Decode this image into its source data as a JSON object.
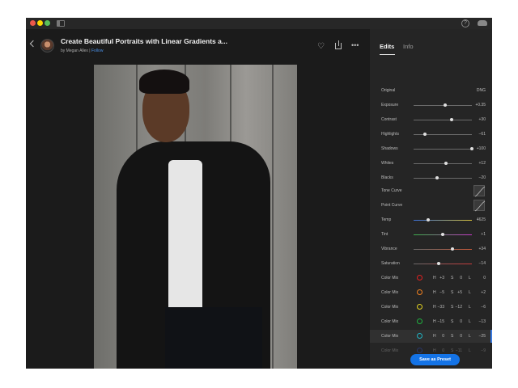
{
  "header": {
    "title": "Create Beautiful Portraits with Linear Gradients a...",
    "byline_prefix": "by Megan Allex |",
    "follow": "Follow"
  },
  "panel": {
    "tabs": [
      {
        "label": "Edits"
      },
      {
        "label": "Info"
      }
    ],
    "original_label": "Original",
    "original_value": "DNG",
    "sliders": [
      {
        "label": "Exposure",
        "value": "+0.35",
        "position": 0.54
      },
      {
        "label": "Contrast",
        "value": "+30",
        "position": 0.65
      },
      {
        "label": "Highlights",
        "value": "−61",
        "position": 0.19
      },
      {
        "label": "Shadows",
        "value": "+100",
        "position": 1.0
      },
      {
        "label": "Whites",
        "value": "+12",
        "position": 0.56
      },
      {
        "label": "Blacks",
        "value": "−20",
        "position": 0.4
      }
    ],
    "tone_curve_label": "Tone Curve",
    "point_curve_label": "Point Curve",
    "color_sliders": [
      {
        "label": "Temp",
        "value": "4625",
        "position": 0.25
      },
      {
        "label": "Tint",
        "value": "+1",
        "position": 0.5
      },
      {
        "label": "Vibrance",
        "value": "+34",
        "position": 0.66
      },
      {
        "label": "Saturation",
        "value": "−14",
        "position": 0.43
      }
    ],
    "color_mix": [
      {
        "label": "Color Mix",
        "color": "#e02020",
        "h": "+3",
        "s": "0",
        "l": "0"
      },
      {
        "label": "Color Mix",
        "color": "#f08020",
        "h": "−5",
        "s": "+5",
        "l": "+2"
      },
      {
        "label": "Color Mix",
        "color": "#e0d020",
        "h": "−33",
        "s": "−12",
        "l": "−6"
      },
      {
        "label": "Color Mix",
        "color": "#20b040",
        "h": "−15",
        "s": "0",
        "l": "−13"
      },
      {
        "label": "Color Mix",
        "color": "#20b0c0",
        "h": "0",
        "s": "0",
        "l": "−25"
      },
      {
        "label": "Color Mix",
        "color": "#3050d0",
        "h": "0",
        "s": "−11",
        "l": "−9"
      }
    ],
    "hsl_letters": {
      "h": "H",
      "s": "S",
      "l": "L"
    },
    "save_preset": "Save as Preset"
  }
}
